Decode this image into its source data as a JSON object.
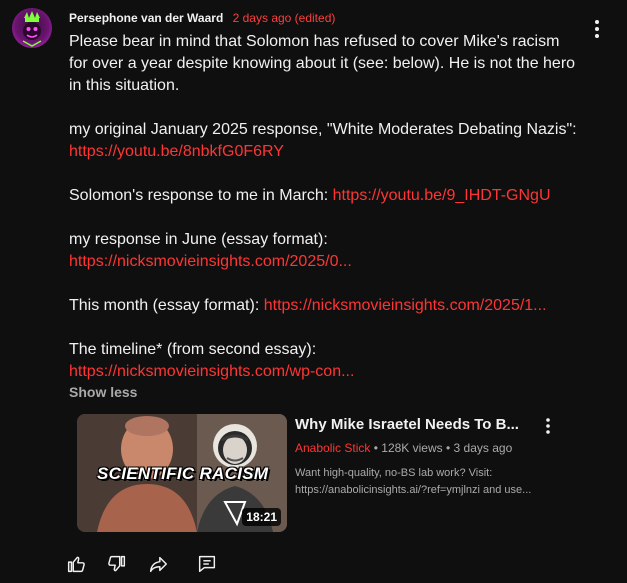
{
  "comment": {
    "author": "Persephone van der Waard",
    "timestamp": "2 days ago (edited)",
    "body": [
      {
        "type": "text",
        "text": "Please bear in mind that Solomon has refused to cover Mike's racism"
      },
      {
        "type": "text",
        "text": "for over a year despite knowing about it (see: below). He is not the hero"
      },
      {
        "type": "text",
        "text": "in this situation."
      },
      {
        "type": "gap"
      },
      {
        "type": "text",
        "text": "my original January 2025 response, \"White Moderates Debating Nazis\":"
      },
      {
        "type": "link",
        "text": "https://youtu.be/8nbkfG0F6RY"
      },
      {
        "type": "gap"
      },
      {
        "type": "mixed",
        "text": "Solomon's response to me in March: ",
        "link": "https://youtu.be/9_IHDT-GNgU"
      },
      {
        "type": "gap"
      },
      {
        "type": "text",
        "text": "my response in June (essay format):"
      },
      {
        "type": "link",
        "text": "https://nicksmovieinsights.com/2025/0..."
      },
      {
        "type": "gap"
      },
      {
        "type": "mixed",
        "text": "This month (essay format): ",
        "link": "https://nicksmovieinsights.com/2025/1..."
      },
      {
        "type": "gap"
      },
      {
        "type": "text",
        "text": "The timeline* (from second essay):"
      },
      {
        "type": "link",
        "text": "https://nicksmovieinsights.com/wp-con..."
      }
    ],
    "show_less_label": "Show less",
    "colors": {
      "link": "#ff3535",
      "timestamp": "#ff3d3d",
      "muted": "#aaaaaa",
      "background": "#0f0f0f"
    }
  },
  "video": {
    "thumbnail_text": "SCIENTIFIC RACISM",
    "duration": "18:21",
    "title": "Why Mike Israetel Needs To B...",
    "channel": "Anabolic Stick",
    "views": "128K views",
    "age": "3 days ago",
    "desc_line1": "Want high-quality, no-BS lab work? Visit:",
    "desc_line2": "https://anabolicinsights.ai/?ref=ymjlnzi and use..."
  },
  "actions": {
    "icons": [
      "thumbs-up-icon",
      "thumbs-down-icon",
      "share-icon",
      "reply-icon"
    ]
  }
}
